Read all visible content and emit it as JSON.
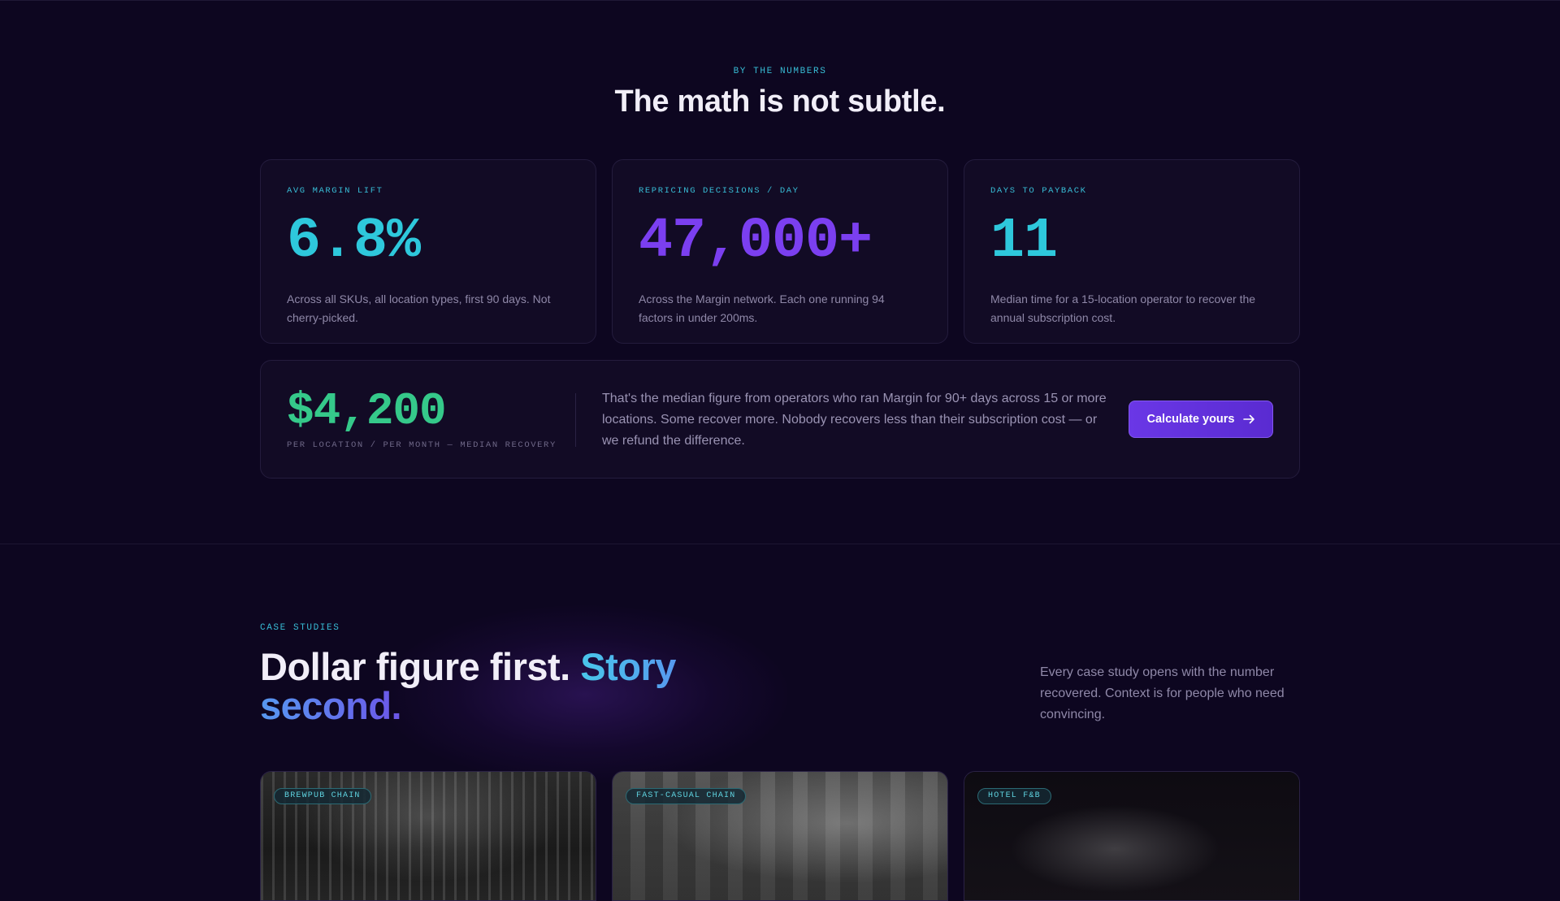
{
  "numbers": {
    "eyebrow": "BY THE NUMBERS",
    "title": "The math is not subtle.",
    "stats": [
      {
        "label": "AVG MARGIN LIFT",
        "value": "6.8%",
        "description": "Across all SKUs, all location types, first 90 days. Not cherry-picked.",
        "color": "#2ec8dc"
      },
      {
        "label": "REPRICING DECISIONS / DAY",
        "value": "47,000+",
        "description": "Across the Margin network. Each one running 94 factors in under 200ms.",
        "color": "#7b3ff0"
      },
      {
        "label": "DAYS TO PAYBACK",
        "value": "11",
        "description": "Median time for a 15-location operator to recover the annual subscription cost.",
        "color": "#2ec8dc"
      }
    ],
    "recovery": {
      "value": "$4,200",
      "sublabel": "PER LOCATION / PER MONTH — MEDIAN RECOVERY",
      "text": "That's the median figure from operators who ran Margin for 90+ days across 15 or more locations. Some recover more. Nobody recovers less than their subscription cost — or we refund the difference.",
      "cta_label": "Calculate yours",
      "cta_icon": "arrow-right-icon",
      "color": "#35c98a"
    }
  },
  "case_studies": {
    "eyebrow": "CASE STUDIES",
    "title_plain": "Dollar figure first. ",
    "title_gradient": "Story second.",
    "side_text": "Every case study opens with the number recovered. Context is for people who need convincing.",
    "cards": [
      {
        "tag": "BREWPUB CHAIN"
      },
      {
        "tag": "FAST-CASUAL CHAIN"
      },
      {
        "tag": "HOTEL F&B"
      }
    ]
  },
  "colors": {
    "background": "#0d0620",
    "accent_cyan": "#38bdd6",
    "accent_purple": "#6a37e6",
    "accent_green": "#35c98a"
  }
}
